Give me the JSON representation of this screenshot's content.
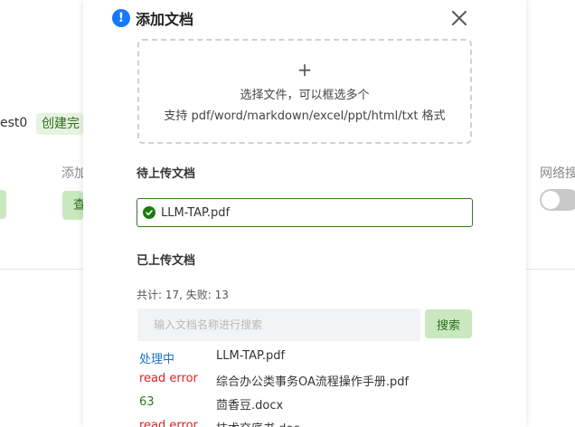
{
  "background": {
    "name_fragment": "est0",
    "badge": "创建完",
    "label_add": "添加",
    "btn_view": "查",
    "label_web": "网络搜"
  },
  "modal": {
    "title": "添加文档",
    "info_icon": "!",
    "upload": {
      "plus": "+",
      "line1": "选择文件，可以框选多个",
      "line2": "支持 pdf/word/markdown/excel/ppt/html/txt 格式"
    },
    "pending": {
      "title": "待上传文档",
      "file": "LLM-TAP.pdf"
    },
    "uploaded": {
      "title": "已上传文档",
      "stats": "共计: 17, 失败: 13",
      "search_placeholder": "输入文档名称进行搜索",
      "search_button": "搜索",
      "files": [
        {
          "status": "处理中",
          "status_color": "#1a73c9",
          "name": "LLM-TAP.pdf"
        },
        {
          "status": "read error",
          "status_color": "#e02020",
          "name": "综合办公类事务OA流程操作手册.pdf"
        },
        {
          "status": "63",
          "status_color": "#2e7d18",
          "name": "茴香豆.docx"
        },
        {
          "status": "read error",
          "status_color": "#e02020",
          "name": "技术交底书.doc"
        }
      ]
    }
  },
  "colors": {
    "accent_green": "#c9e8bf",
    "info_blue": "#1677ff",
    "success_green": "#1e7a12"
  }
}
